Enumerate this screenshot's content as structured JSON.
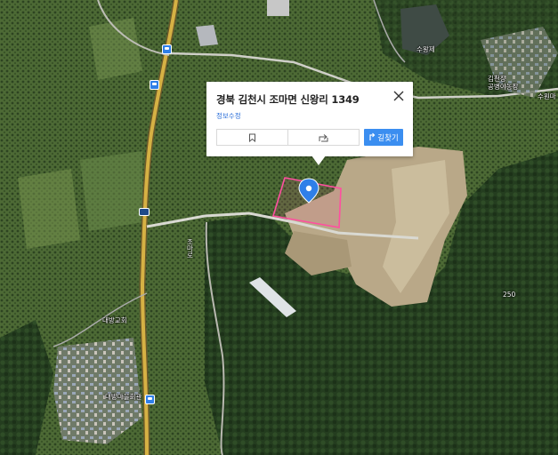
{
  "popup": {
    "title": "경북 김천시 조마면 신왕리 1349",
    "edit_label": "정보수정",
    "route_label": "길찾기"
  },
  "map_labels": {
    "reservoir": "수왕제",
    "agency_line1": "김천장",
    "agency_line2": "공병이농장",
    "road_right": "수원마",
    "elevation": "250",
    "road_side": "조마로",
    "church": "대방교회",
    "hall": "대방마을회관",
    "road_number": "59"
  },
  "colors": {
    "parcel_outline": "#ff4fa0",
    "marker": "#2f7fe8",
    "route_button": "#3b8ef0",
    "edit_link": "#2b6fd9"
  }
}
